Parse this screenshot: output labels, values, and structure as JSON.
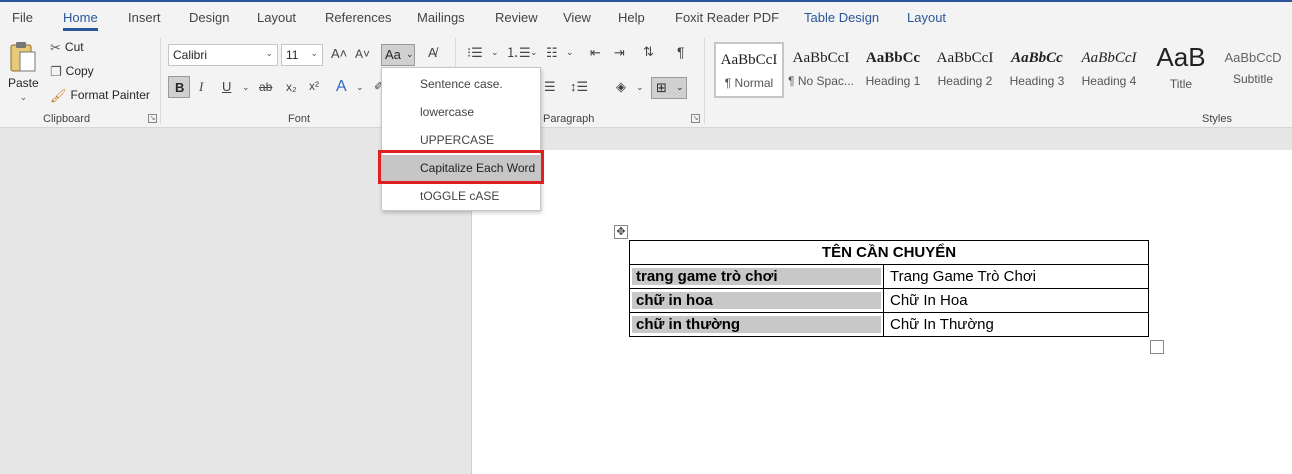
{
  "menu_tabs": [
    {
      "label": "File"
    },
    {
      "label": "Home"
    },
    {
      "label": "Insert"
    },
    {
      "label": "Design"
    },
    {
      "label": "Layout"
    },
    {
      "label": "References"
    },
    {
      "label": "Mailings"
    },
    {
      "label": "Review"
    },
    {
      "label": "View"
    },
    {
      "label": "Help"
    },
    {
      "label": "Foxit Reader PDF"
    },
    {
      "label": "Table Design"
    },
    {
      "label": "Layout"
    }
  ],
  "active_tab": "Home",
  "clipboard": {
    "paste_label": "Paste",
    "cut_label": "Cut",
    "copy_label": "Copy",
    "format_painter_label": "Format Painter",
    "group_label": "Clipboard"
  },
  "font": {
    "font_name": "Calibri",
    "font_size": "11",
    "change_case_label": "Aa",
    "group_label": "Font",
    "bold_label": "B",
    "italic_label": "I",
    "underline_label": "U",
    "strike_label": "ab",
    "subscript_label": "x₂",
    "superscript_label": "x²"
  },
  "paragraph": {
    "group_label": "Paragraph"
  },
  "styles": {
    "group_label": "Styles",
    "items": [
      {
        "sample": "AaBbCcI",
        "name": "¶ Normal"
      },
      {
        "sample": "AaBbCcI",
        "name": "¶ No Spac..."
      },
      {
        "sample": "AaBbCc",
        "name": "Heading 1"
      },
      {
        "sample": "AaBbCcI",
        "name": "Heading 2"
      },
      {
        "sample": "AaBbCc",
        "name": "Heading 3"
      },
      {
        "sample": "AaBbCcI",
        "name": "Heading 4"
      },
      {
        "sample": "AaB",
        "name": "Title"
      },
      {
        "sample": "AaBbCcD",
        "name": "Subtitle"
      }
    ]
  },
  "change_case_menu": {
    "items": [
      {
        "label": "Sentence case."
      },
      {
        "label": "lowercase"
      },
      {
        "label": "UPPERCASE"
      },
      {
        "label": "Capitalize Each Word"
      },
      {
        "label": "tOGGLE cASE"
      }
    ],
    "highlighted": "Capitalize Each Word"
  },
  "table": {
    "header": "TÊN CẦN CHUYỂN",
    "rows": [
      {
        "left": "trang game trò chơi",
        "right": "Trang Game Trò Chơi"
      },
      {
        "left": "chữ in hoa",
        "right": "Chữ In Hoa"
      },
      {
        "left": "chữ in thường",
        "right": "Chữ In Thường"
      }
    ]
  },
  "colors": {
    "accent": "#2b579a",
    "highlight_box": "#e02020"
  }
}
